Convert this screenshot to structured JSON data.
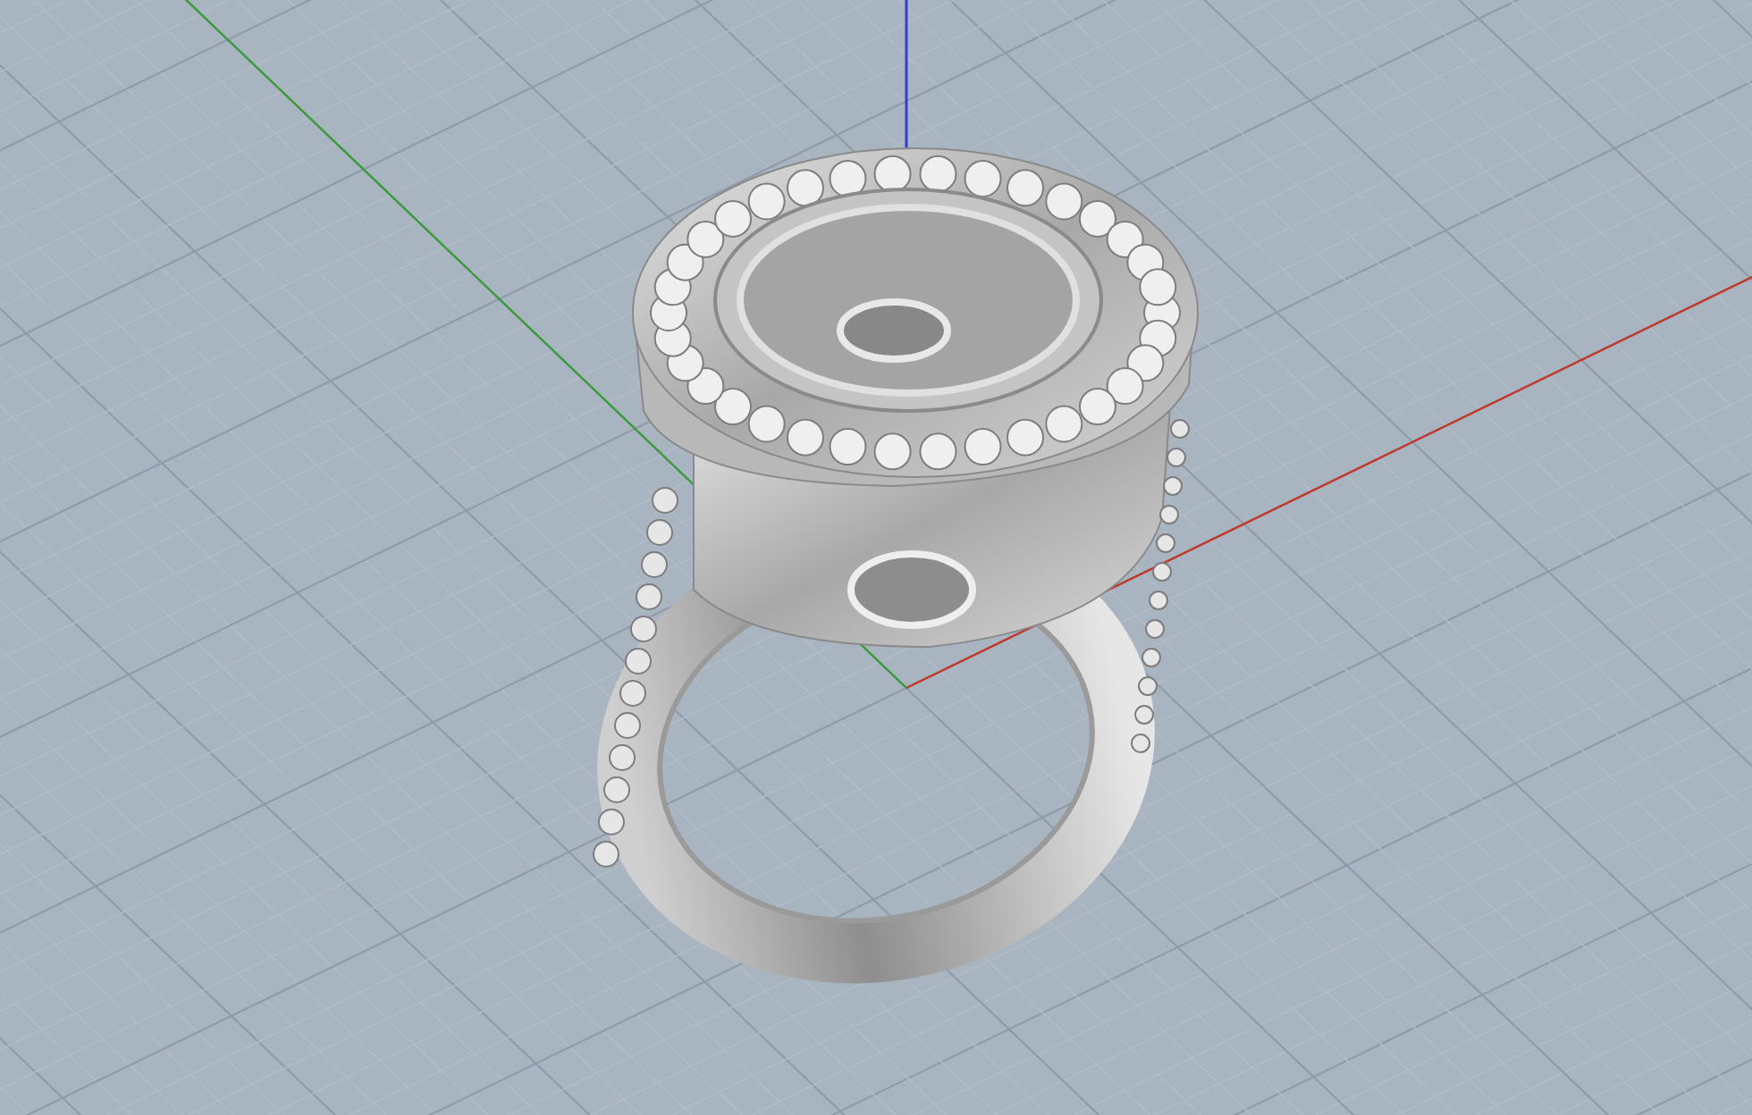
{
  "viewport": {
    "axes": [
      {
        "kind": "x",
        "color": "#c0392b"
      },
      {
        "kind": "y",
        "color": "#3a9b3a"
      },
      {
        "kind": "z",
        "color": "#3b3bd0"
      }
    ]
  }
}
